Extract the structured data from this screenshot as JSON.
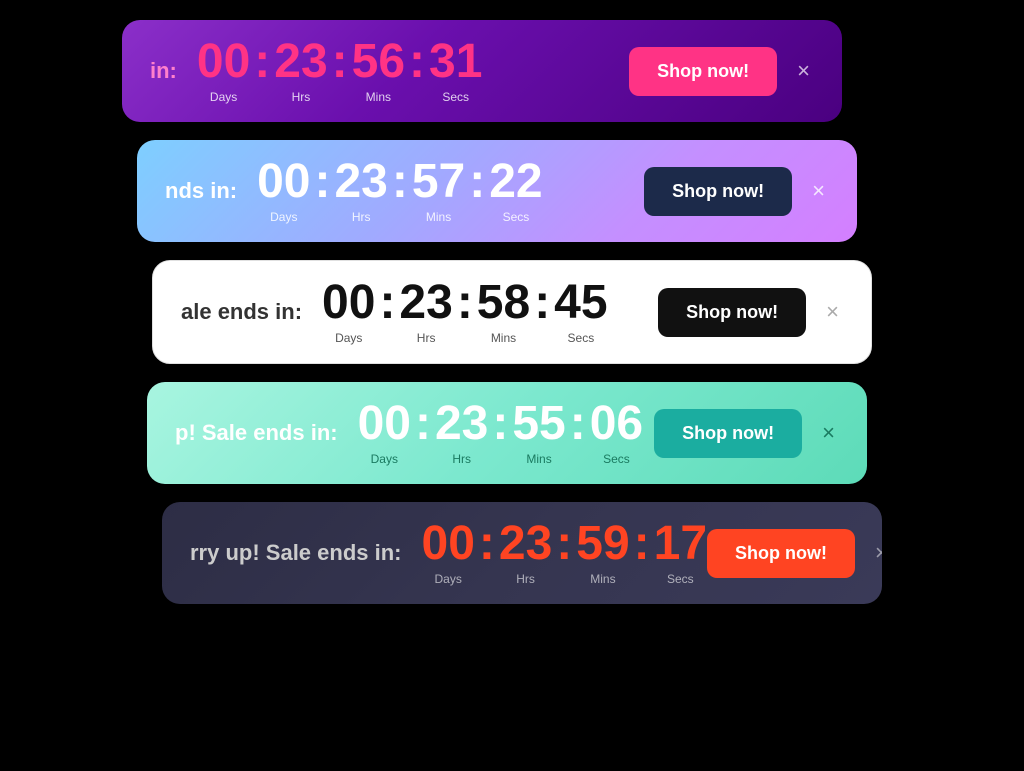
{
  "banners": [
    {
      "id": "banner-1",
      "label": "in:",
      "countdown": {
        "days": "00",
        "hrs": "23",
        "mins": "56",
        "secs": "31"
      },
      "labels": {
        "days": "Days",
        "hrs": "Hrs",
        "mins": "Mins",
        "secs": "Secs"
      },
      "shopLabel": "Shop now!",
      "theme": "purple"
    },
    {
      "id": "banner-2",
      "label": "nds in:",
      "countdown": {
        "days": "00",
        "hrs": "23",
        "mins": "57",
        "secs": "22"
      },
      "labels": {
        "days": "Days",
        "hrs": "Hrs",
        "mins": "Mins",
        "secs": "Secs"
      },
      "shopLabel": "Shop now!",
      "theme": "cyan-purple"
    },
    {
      "id": "banner-3",
      "label": "ale ends in:",
      "countdown": {
        "days": "00",
        "hrs": "23",
        "mins": "58",
        "secs": "45"
      },
      "labels": {
        "days": "Days",
        "hrs": "Hrs",
        "mins": "Mins",
        "secs": "Secs"
      },
      "shopLabel": "Shop now!",
      "theme": "white"
    },
    {
      "id": "banner-4",
      "label": "p! Sale ends in:",
      "countdown": {
        "days": "00",
        "hrs": "23",
        "mins": "55",
        "secs": "06"
      },
      "labels": {
        "days": "Days",
        "hrs": "Hrs",
        "mins": "Mins",
        "secs": "Secs"
      },
      "shopLabel": "Shop now!",
      "theme": "mint"
    },
    {
      "id": "banner-5",
      "label": "rry up! Sale ends in:",
      "countdown": {
        "days": "00",
        "hrs": "23",
        "mins": "59",
        "secs": "17"
      },
      "labels": {
        "days": "Days",
        "hrs": "Hrs",
        "mins": "Mins",
        "secs": "Secs"
      },
      "shopLabel": "Shop now!",
      "theme": "dark"
    }
  ],
  "close": "×"
}
